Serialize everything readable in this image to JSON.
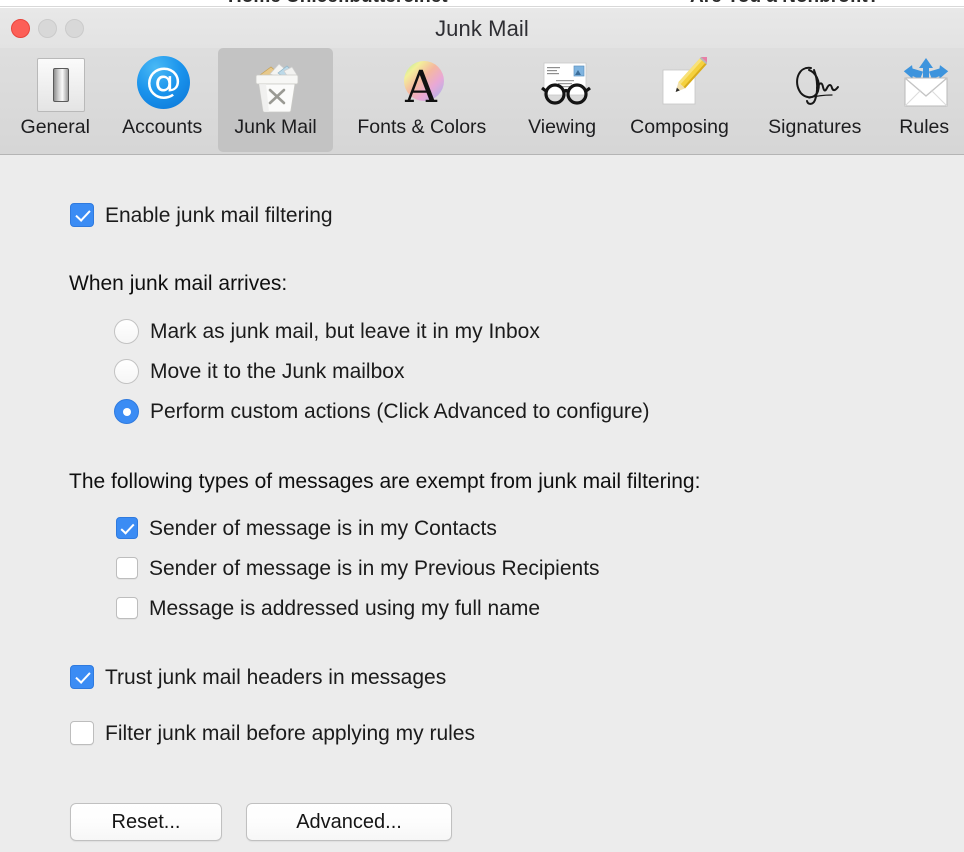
{
  "background_page": {
    "clipped_text_left": "Home  Unicef.butterc.net",
    "clipped_text_right": "Are You a Nonbrofit?"
  },
  "window": {
    "title": "Junk Mail",
    "controls": {
      "close": "close-button",
      "minimize": "minimize-button",
      "zoom": "zoom-button"
    }
  },
  "toolbar": {
    "selected": "Junk Mail",
    "tabs": [
      {
        "label": "General",
        "icon": "light-switch-icon"
      },
      {
        "label": "Accounts",
        "icon": "at-sign-icon"
      },
      {
        "label": "Junk Mail",
        "icon": "trash-can-icon"
      },
      {
        "label": "Fonts & Colors",
        "icon": "color-wheel-letter-a-icon"
      },
      {
        "label": "Viewing",
        "icon": "envelope-eyeglasses-icon"
      },
      {
        "label": "Composing",
        "icon": "pencil-paper-icon"
      },
      {
        "label": "Signatures",
        "icon": "signature-icon"
      },
      {
        "label": "Rules",
        "icon": "envelope-arrows-icon"
      }
    ]
  },
  "main": {
    "enable": {
      "label": "Enable junk mail filtering",
      "checked": true
    },
    "arrives": {
      "heading": "When junk mail arrives:",
      "options": [
        {
          "label": "Mark as junk mail, but leave it in my Inbox",
          "selected": false
        },
        {
          "label": "Move it to the Junk mailbox",
          "selected": false
        },
        {
          "label": "Perform custom actions (Click Advanced to configure)",
          "selected": true
        }
      ]
    },
    "exempt": {
      "heading": "The following types of messages are exempt from junk mail filtering:",
      "options": [
        {
          "label": "Sender of message is in my Contacts",
          "checked": true
        },
        {
          "label": "Sender of message is in my Previous Recipients",
          "checked": false
        },
        {
          "label": "Message is addressed using my full name",
          "checked": false
        }
      ]
    },
    "trust_headers": {
      "label": "Trust junk mail headers in messages",
      "checked": true
    },
    "filter_before_rules": {
      "label": "Filter junk mail before applying my rules",
      "checked": false
    },
    "buttons": {
      "reset": "Reset...",
      "advanced": "Advanced..."
    }
  },
  "colors": {
    "accent": "#3b8cf4",
    "content_bg": "#ececec",
    "toolbar_bg": "#d9d9d9",
    "selected_tab_bg": "#c3c3c3",
    "close_button": "#fc5f57"
  }
}
